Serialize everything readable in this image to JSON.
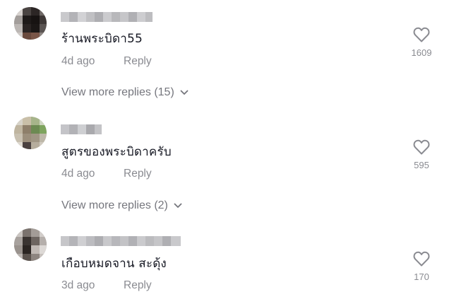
{
  "comments": [
    {
      "username": "",
      "text": "ร้านพระบิดา55",
      "date": "4d ago",
      "reply_label": "Reply",
      "likes": "1609",
      "view_more": "View more replies (15)"
    },
    {
      "username": "",
      "text": "สูตรของพระบิดาครับ",
      "date": "4d ago",
      "reply_label": "Reply",
      "likes": "595",
      "view_more": "View more replies (2)"
    },
    {
      "username": "",
      "text": "เกือบหมดจาน สะดุ้ง",
      "date": "3d ago",
      "reply_label": "Reply",
      "likes": "170"
    }
  ],
  "icons": {
    "like": "heart-outline-icon",
    "expand": "chevron-down-icon"
  },
  "colors": {
    "text": "#161823",
    "muted": "#8a8b91",
    "view_more": "#75767d",
    "icon": "#8a8b91"
  }
}
